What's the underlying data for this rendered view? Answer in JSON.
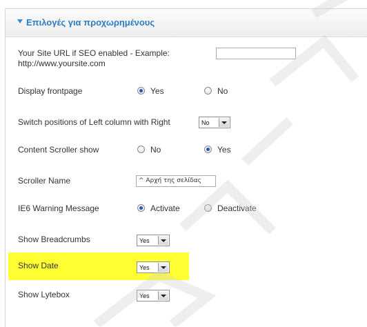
{
  "panel": {
    "title": "Επιλογές για προχωρημένους",
    "accent_color": "#2d7cc2"
  },
  "rows": {
    "site_url": {
      "label": "Your Site URL if SEO enabled - Example: http://www.yoursite.com",
      "value": ""
    },
    "display_frontpage": {
      "label": "Display frontpage",
      "opt1": "Yes",
      "opt2": "No",
      "selected": "Yes"
    },
    "switch_positions": {
      "label": "Switch positions of Left column with Right",
      "value": "No"
    },
    "content_scroller": {
      "label": "Content Scroller show",
      "opt1": "No",
      "opt2": "Yes",
      "selected": "Yes"
    },
    "scroller_name": {
      "label": "Scroller Name",
      "value": "^ Αρχή της σελίδας"
    },
    "ie6_warning": {
      "label": "IE6 Warning Message",
      "opt1": "Activate",
      "opt2": "Deactivate",
      "selected": "Activate"
    },
    "show_breadcrumbs": {
      "label": "Show Breadcrumbs",
      "value": "Yes"
    },
    "show_date": {
      "label": "Show Date",
      "value": "Yes",
      "highlight_color": "#ffff33"
    },
    "show_lytebox": {
      "label": "Show Lytebox",
      "value": "Yes"
    }
  }
}
